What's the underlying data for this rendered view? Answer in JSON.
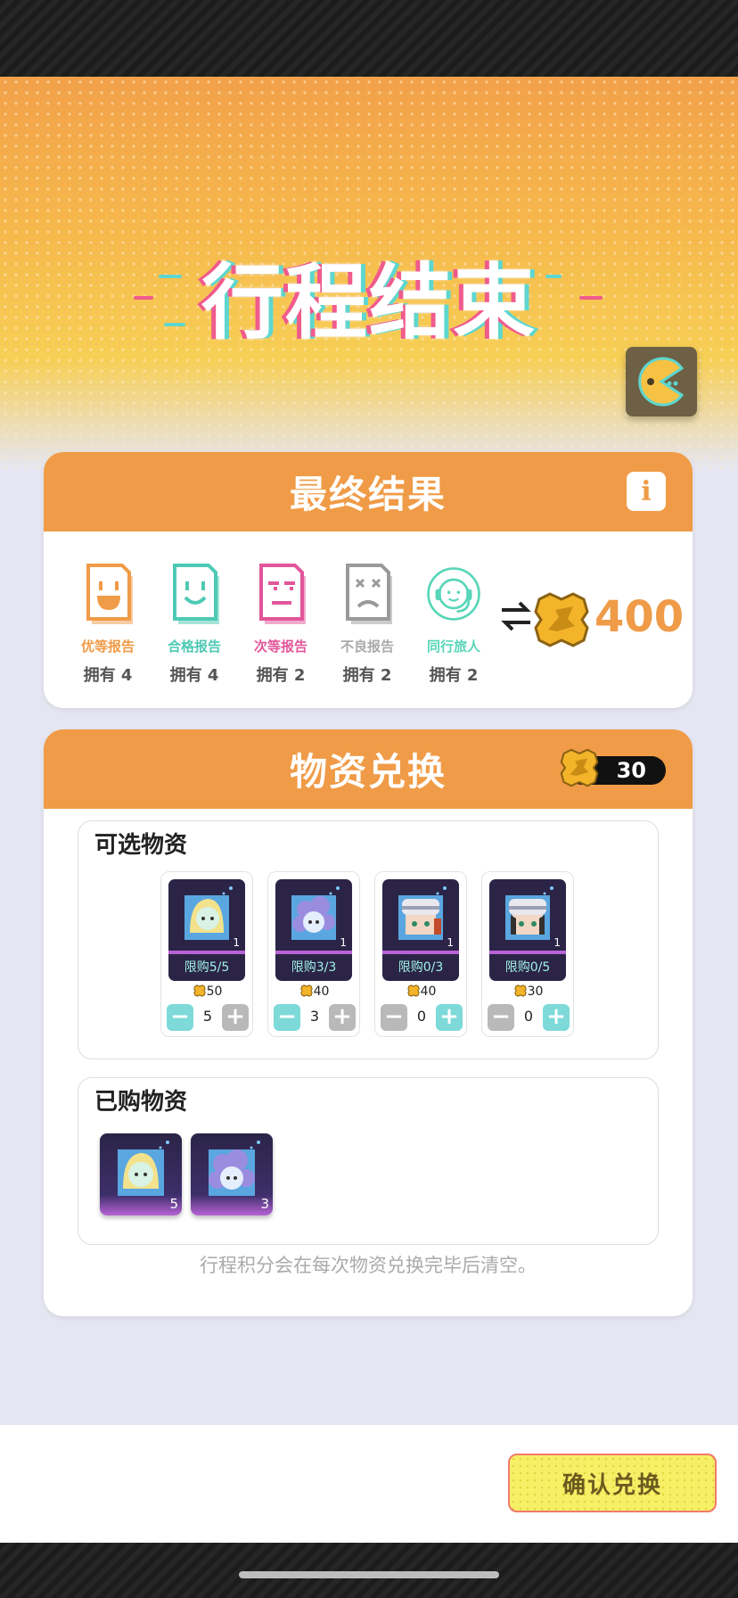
{
  "hero": {
    "title": "行程结束"
  },
  "results": {
    "title": "最终结果",
    "reports": [
      {
        "label": "优等报告",
        "count": "拥有 4",
        "color": "#f09b47"
      },
      {
        "label": "合格报告",
        "count": "拥有 4",
        "color": "#4ec9b4"
      },
      {
        "label": "次等报告",
        "count": "拥有 2",
        "color": "#e2569a"
      },
      {
        "label": "不良报告",
        "count": "拥有 2",
        "color": "#aaaaaa"
      },
      {
        "label": "同行旅人",
        "count": "拥有 2",
        "color": "#58d6b8"
      }
    ],
    "total_points": "400"
  },
  "exchange": {
    "title": "物资兑换",
    "points": "30",
    "selectable_title": "可选物资",
    "goods": [
      {
        "qty": "1",
        "limit": "限购5/5",
        "price": "50",
        "value": "5",
        "minus_color": "#7ed9d9",
        "plus_color": "#b9b9b9"
      },
      {
        "qty": "1",
        "limit": "限购3/3",
        "price": "40",
        "value": "3",
        "minus_color": "#7ed9d9",
        "plus_color": "#b9b9b9"
      },
      {
        "qty": "1",
        "limit": "限购0/3",
        "price": "40",
        "value": "0",
        "minus_color": "#b9b9b9",
        "plus_color": "#7ed9d9"
      },
      {
        "qty": "1",
        "limit": "限购0/5",
        "price": "30",
        "value": "0",
        "minus_color": "#b9b9b9",
        "plus_color": "#7ed9d9"
      }
    ],
    "purchased_title": "已购物资",
    "purchased": [
      {
        "count": "5"
      },
      {
        "count": "3"
      }
    ],
    "note": "行程积分会在每次物资兑换完毕后清空。"
  },
  "confirm": {
    "label": "确认兑换"
  },
  "colors": {
    "accent": "#f09b47",
    "teal": "#7ed9d9",
    "purple": "#2b2447"
  }
}
